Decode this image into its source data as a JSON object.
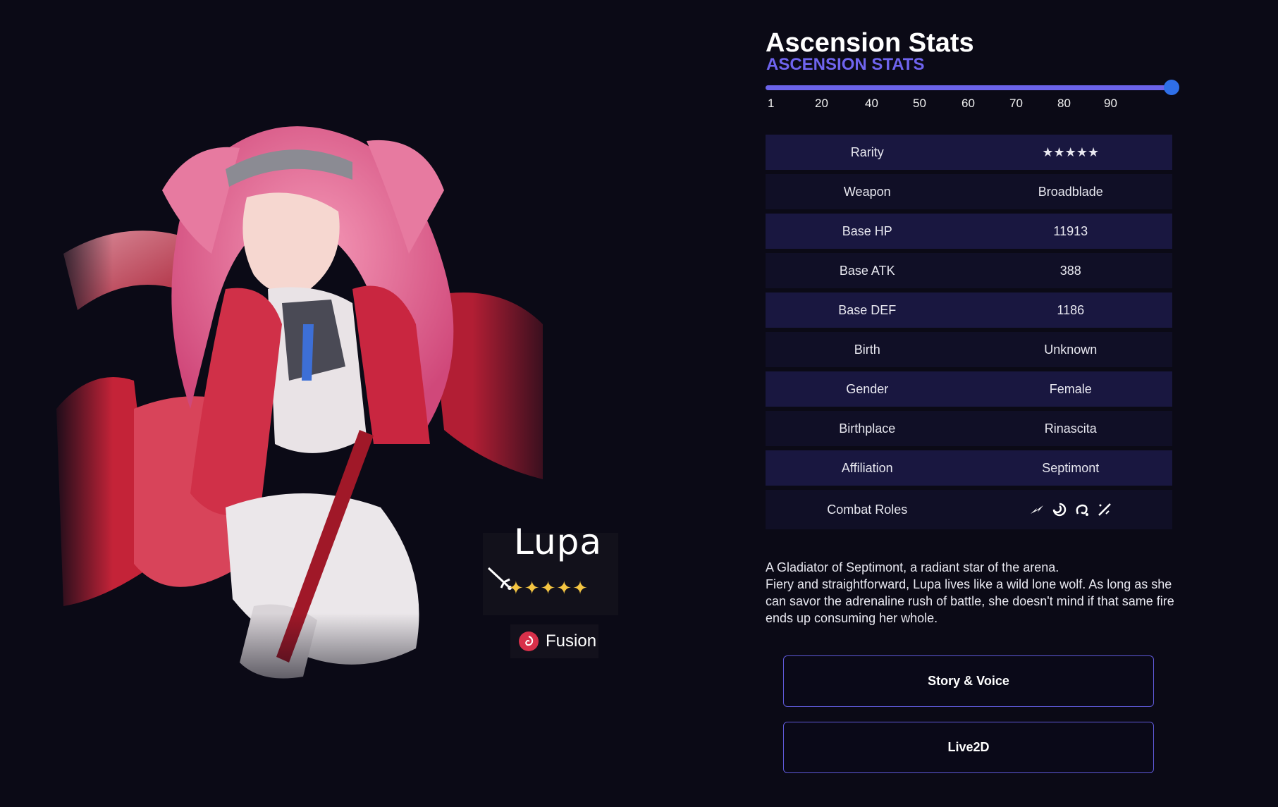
{
  "character": {
    "name": "Lupa",
    "stars": "✦✦✦✦✦",
    "element": "Fusion"
  },
  "stats": {
    "title": "Ascension Stats",
    "subtitle": "ASCENSION STATS",
    "level_selected": 90,
    "level_max": 90,
    "level_ticks": [
      "1",
      "20",
      "40",
      "50",
      "60",
      "70",
      "80",
      "90"
    ],
    "rows": [
      {
        "label": "Rarity",
        "value": "★★★★★"
      },
      {
        "label": "Weapon",
        "value": "Broadblade"
      },
      {
        "label": "Base HP",
        "value": "11913"
      },
      {
        "label": "Base ATK",
        "value": "388"
      },
      {
        "label": "Base DEF",
        "value": "1186"
      },
      {
        "label": "Birth",
        "value": "Unknown"
      },
      {
        "label": "Gender",
        "value": "Female"
      },
      {
        "label": "Birthplace",
        "value": "Rinascita"
      },
      {
        "label": "Affiliation",
        "value": "Septimont"
      },
      {
        "label": "Combat Roles",
        "value": ""
      }
    ],
    "combat_role_icons": [
      "role-burst-icon",
      "role-spiral-icon",
      "role-swirl-icon",
      "role-blade-icon"
    ]
  },
  "description": {
    "line1": "A Gladiator of Septimont, a radiant star of the arena.",
    "line2": "Fiery and straightforward, Lupa lives like a wild lone wolf. As long as she can savor the adrenaline rush of battle, she doesn't mind if that same fire ends up consuming her whole."
  },
  "buttons": {
    "story": "Story & Voice",
    "live2d": "Live2D"
  },
  "colors": {
    "background": "#0b0a16",
    "accent": "#6f64ee",
    "row_odd": "#191740",
    "row_even": "#100f26",
    "fusion": "#d8304a",
    "star": "#f4c542"
  }
}
